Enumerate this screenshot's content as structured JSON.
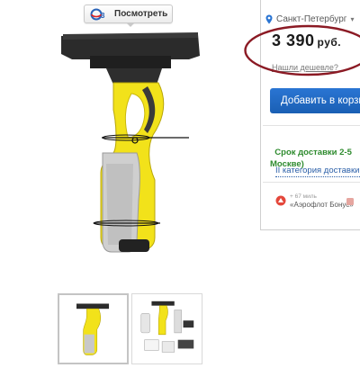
{
  "gallery": {
    "view_button": {
      "label": "Посмотреть",
      "icon": "3d-view-icon"
    },
    "main_image": {
      "icon": "window-vacuum-cleaner-product-image"
    },
    "thumbnails": [
      {
        "name": "thumbnail-product",
        "active": true
      },
      {
        "name": "thumbnail-kit",
        "active": false
      }
    ]
  },
  "offer": {
    "city": "Санкт-Петербург",
    "price": "3 390",
    "currency": "руб.",
    "cheaper_link": "Нашли дешевле?",
    "add_to_cart": "Добавить в корзину",
    "delivery": "Срок доставки 2-5\nМоскве)",
    "category": "II категория доставки",
    "bonus": {
      "miles": "+ 67 миль",
      "program": "«Аэрофлот Бонус»"
    }
  },
  "colors": {
    "accent_blue": "#1f66c1",
    "delivery_green": "#2e8b2e",
    "annotation_red": "#8b1a24",
    "product_yellow": "#f2e21a"
  }
}
